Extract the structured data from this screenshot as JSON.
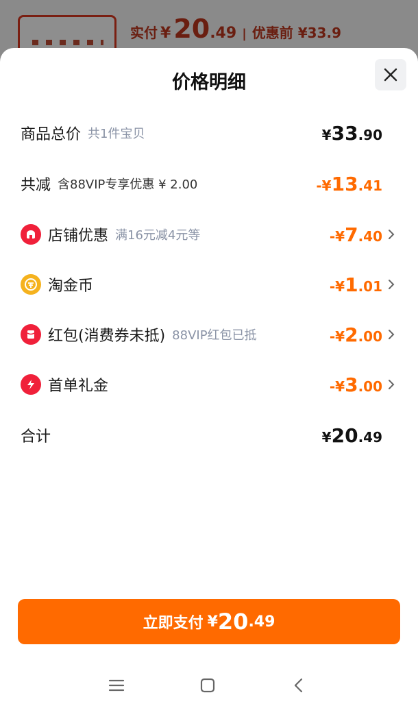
{
  "top": {
    "label": "实付",
    "yen": "¥",
    "price_int": "20",
    "price_dec": ".49",
    "separator": "|",
    "orig_label": "优惠前 ¥33.9"
  },
  "sheet": {
    "title": "价格明细"
  },
  "rows": {
    "total_goods": {
      "label": "商品总价",
      "sub": "共1件宝贝",
      "yen": "¥",
      "int": "33",
      "dec": ".90"
    },
    "total_reduce": {
      "label": "共减",
      "sub": "含88VIP专享优惠 ¥ 2.00",
      "yen": "-¥",
      "int": "13",
      "dec": ".41"
    },
    "shop_discount": {
      "label": "店铺优惠",
      "sub": "满16元减4元等",
      "yen": "-¥",
      "int": "7",
      "dec": ".40",
      "icon": "shop-icon"
    },
    "taojinbi": {
      "label": "淘金币",
      "yen": "-¥",
      "int": "1",
      "dec": ".01",
      "icon": "coin-icon"
    },
    "red_packet": {
      "label": "红包(消费券未抵)",
      "sub": "88VIP红包已抵",
      "yen": "-¥",
      "int": "2",
      "dec": ".00",
      "icon": "red-packet-icon"
    },
    "first_order": {
      "label": "首单礼金",
      "yen": "-¥",
      "int": "3",
      "dec": ".00",
      "icon": "lightning-icon"
    },
    "sum": {
      "label": "合计",
      "yen": "¥",
      "int": "20",
      "dec": ".49"
    }
  },
  "pay_button": {
    "label": "立即支付",
    "yen": "¥",
    "int": "20",
    "dec": ".49"
  },
  "colors": {
    "accent": "#ff6a00",
    "muted": "#8a93a6",
    "red_icon": "#f0203a",
    "gold_icon": "#f5b21e"
  }
}
